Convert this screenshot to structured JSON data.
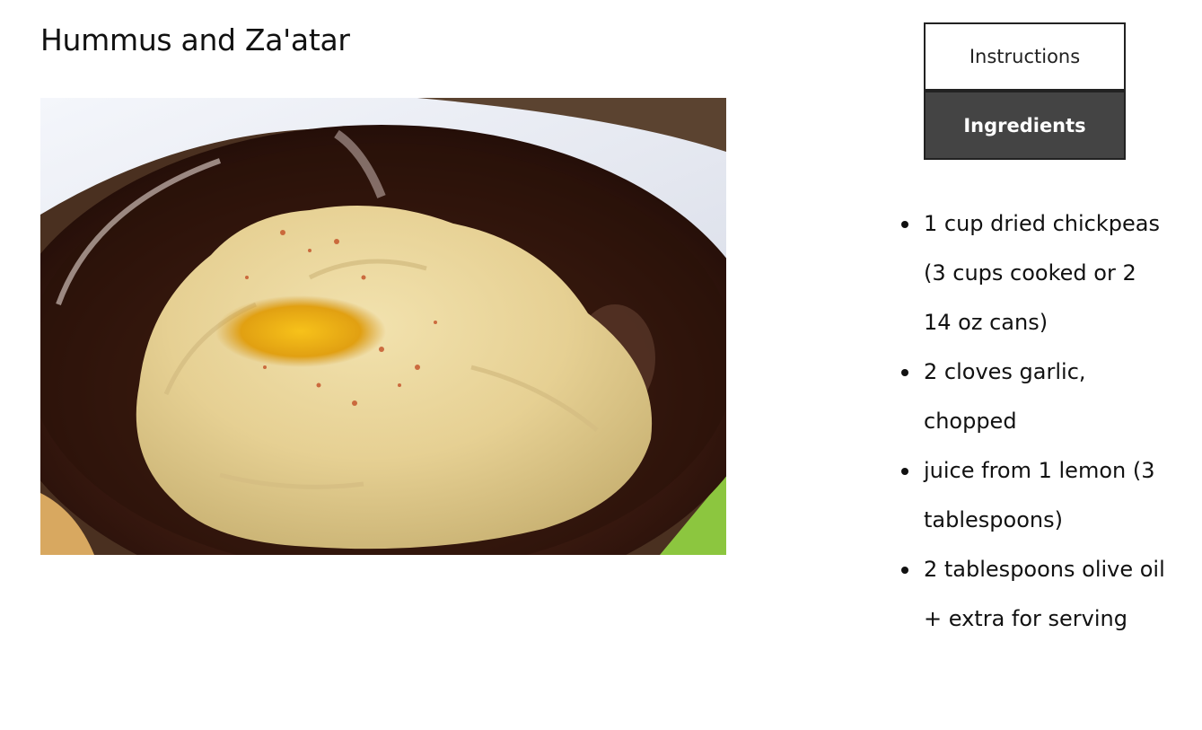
{
  "recipe": {
    "title": "Hummus and Za'atar",
    "image": {
      "alt": "Bowl of hummus drizzled with olive oil and paprika",
      "icon": "hummus-bowl-photo"
    }
  },
  "tabs": [
    {
      "label": "Instructions",
      "selected": false
    },
    {
      "label": "Ingredients",
      "selected": true
    }
  ],
  "ingredients": [
    "1 cup dried chickpeas (3 cups cooked or 2 14 oz cans)",
    "2 cloves garlic, chopped",
    "juice from 1 lemon (3 tablespoons)",
    "2 tablespoons olive oil + extra for serving"
  ],
  "colors": {
    "tab_active_bg": "#444444",
    "tab_border": "#222222",
    "text": "#111111"
  }
}
